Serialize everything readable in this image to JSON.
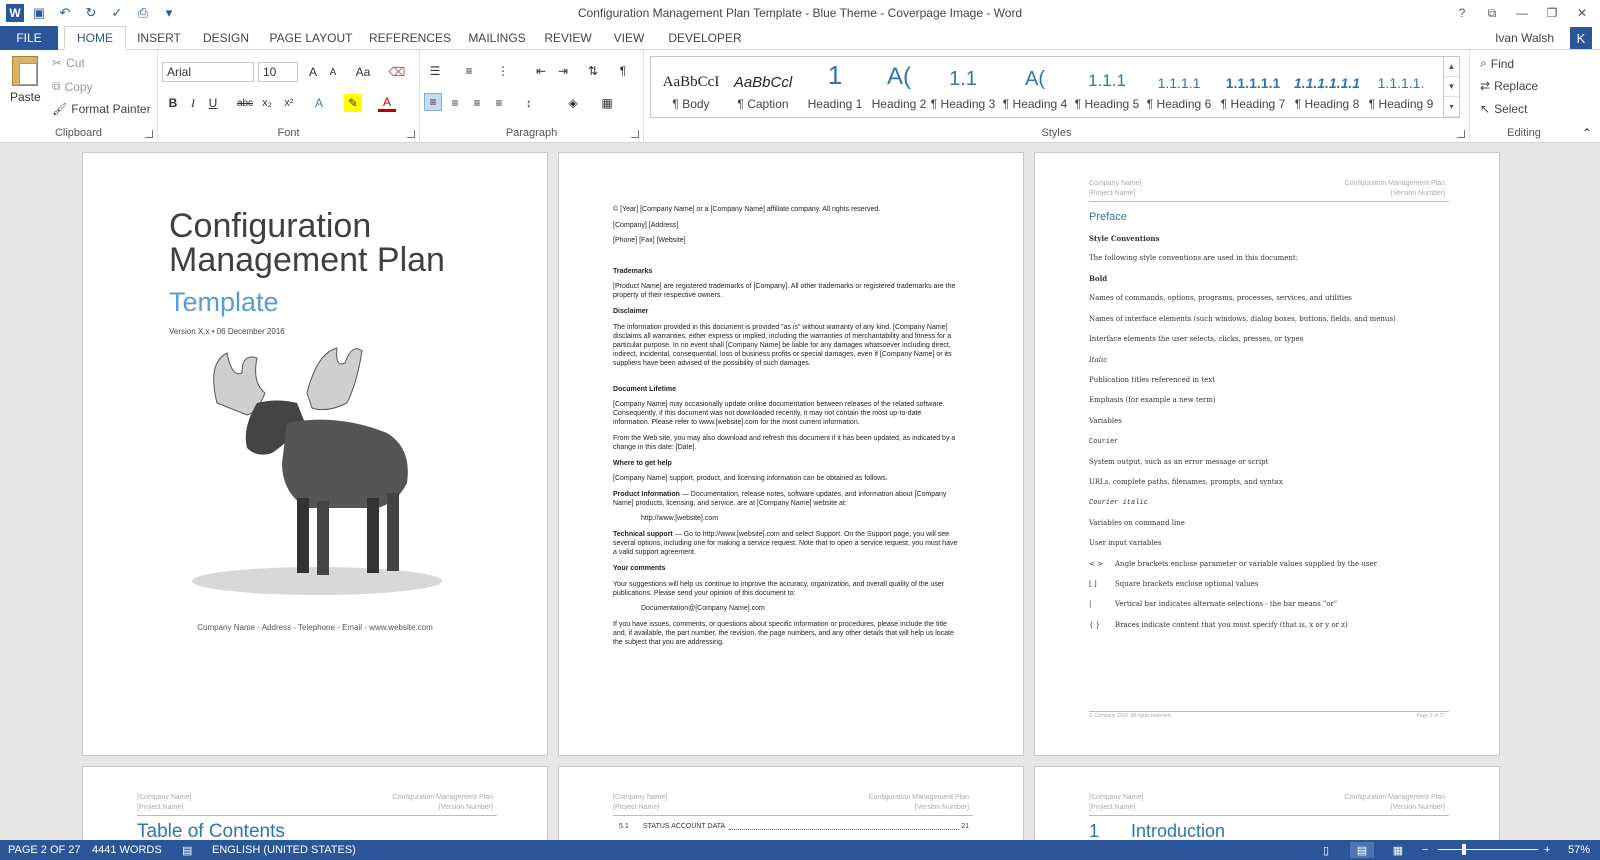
{
  "window": {
    "title": "Configuration Management Plan Template - Blue Theme - Coverpage Image - Word",
    "help": "?",
    "controls": [
      "⧉",
      "—",
      "❐",
      "✕"
    ]
  },
  "qat": {
    "logo": "W",
    "save_icon": "save-icon",
    "undo_icon": "undo-icon",
    "redo_icon": "redo-icon",
    "spell_icon": "spelling-icon",
    "more": "▾"
  },
  "tabs": [
    "FILE",
    "HOME",
    "INSERT",
    "DESIGN",
    "PAGE LAYOUT",
    "REFERENCES",
    "MAILINGS",
    "REVIEW",
    "VIEW",
    "DEVELOPER"
  ],
  "active_tab": "HOME",
  "user": {
    "name": "Ivan Walsh",
    "initial": "K"
  },
  "clipboard": {
    "label": "Clipboard",
    "paste": "Paste",
    "cut": "Cut",
    "copy": "Copy",
    "format_painter": "Format Painter"
  },
  "font": {
    "label": "Font",
    "name": "Arial",
    "size": "10"
  },
  "paragraph": {
    "label": "Paragraph"
  },
  "styles": {
    "label": "Styles",
    "items": [
      {
        "preview": "AaBbCcI",
        "name": "¶ Body"
      },
      {
        "preview": "AaBbCcl",
        "name": "¶ Caption"
      },
      {
        "preview": "1",
        "name": "Heading 1"
      },
      {
        "preview": "A(",
        "name": "Heading 2"
      },
      {
        "preview": "1.1",
        "name": "¶ Heading 3"
      },
      {
        "preview": "A(",
        "name": "¶ Heading 4"
      },
      {
        "preview": "1.1.1",
        "name": "¶ Heading 5"
      },
      {
        "preview": "1.1.1.1",
        "name": "¶ Heading 6"
      },
      {
        "preview": "1.1.1.1.1",
        "name": "¶ Heading 7"
      },
      {
        "preview": "1.1.1.1.1.1",
        "name": "¶ Heading 8"
      },
      {
        "preview": "1.1.1.1.",
        "name": "¶ Heading 9"
      }
    ]
  },
  "editing": {
    "label": "Editing",
    "find": "Find",
    "replace": "Replace",
    "select": "Select"
  },
  "page1": {
    "title_line1": "Configuration",
    "title_line2": "Management Plan",
    "subtitle": "Template",
    "version": "Version X.x • 06 December 2016",
    "footer": "Company Name - Address - Telephone - Email - www.website.com"
  },
  "page2": {
    "copyright": "© [Year] [Company Name] or a [Company Name] affiliate company. All rights reserved.",
    "address": "[Company] [Address]",
    "contact": "[Phone] [Fax] [Website]",
    "trademarks_h": "Trademarks",
    "trademarks": "[Product Name] are registered trademarks of [Company]. All other trademarks or registered trademarks are the property of their respective owners.",
    "disclaimer_h": "Disclaimer",
    "disclaimer": "The information provided in this document is provided \"as is\" without warranty of any kind. [Company Name] disclaims all warranties, either express or implied, including the warranties of merchantability and fitness for a particular purpose. In no event shall [Company Name] be liable for any damages whatsoever including direct, indirect, incidental, consequential, loss of business profits or special damages, even if [Company Name] or its suppliers have been advised of the possibility of such damages.",
    "lifetime_h": "Document Lifetime",
    "lifetime1": "[Company Name] may occasionally update online documentation between releases of the related software. Consequently, if this document was not downloaded recently, it may not contain the most up-to-date information. Please refer to www.[website].com for the most current information.",
    "lifetime2": "From the Web site, you may also download and refresh this document if it has been updated, as indicated by a change in this date: [Date].",
    "help_h": "Where to get help",
    "help": "[Company Name] support, product, and licensing information can be obtained as follows.",
    "product_h": "Product Information",
    "product": " — Documentation, release notes, software updates, and information about [Company Name] products, licensing, and service, are at [Company Name] website at:",
    "product_url": "http://www.[website].com",
    "tech_h": "Technical support",
    "tech": " — Go to http://www.[website].com and select Support. On the Support page, you will see several options, including one for making a service request. Note that to open a service request, you must have a valid support agreement.",
    "comments_h": "Your comments",
    "comments": "Your suggestions will help us continue to improve the accuracy, organization, and overall quality of the user publications. Please send your opinion of this document to:",
    "comments_email": "Documentation@[Company Name].com",
    "issues": "If you have issues, comments, or questions about specific information or procedures, please include the title and, if available, the part number, the revision, the page numbers, and any other details that will help us locate the subject that you are addressing."
  },
  "page3": {
    "hdr_left1": "Company Name]",
    "hdr_left2": "[Project Name]",
    "hdr_right1": "Configuration Management Plan",
    "hdr_right2": "[Version Number]",
    "heading": "Preface",
    "sub": "Style Conventions",
    "intro": "The following style conventions are used in this document:",
    "rows": [
      {
        "a": "Bold",
        "b": ""
      },
      {
        "a": "Names of commands, options, programs, processes, services, and utilities",
        "b": ""
      },
      {
        "a": "Names of interface elements (such windows, dialog boxes, buttons, fields, and menus)",
        "b": ""
      },
      {
        "a": "Interface elements the user selects, clicks, presses, or types",
        "b": ""
      },
      {
        "a": "Italic",
        "b": ""
      },
      {
        "a": "Publication titles referenced in text",
        "b": ""
      },
      {
        "a": "Emphasis (for example a new term)",
        "b": ""
      },
      {
        "a": "Variables",
        "b": ""
      },
      {
        "a": "Courier",
        "b": ""
      },
      {
        "a": "System output, such as an error message or script",
        "b": ""
      },
      {
        "a": "URLs, complete paths, filenames, prompts, and syntax",
        "b": ""
      },
      {
        "a": "Courier italic",
        "b": ""
      },
      {
        "a": "Variables on command line",
        "b": ""
      },
      {
        "a": "User input variables",
        "b": ""
      },
      {
        "a": "< >",
        "b": "Angle brackets enclose parameter or variable values supplied by the user"
      },
      {
        "a": "[ ]",
        "b": "Square brackets enclose optional values"
      },
      {
        "a": "|",
        "b": "Vertical bar indicates alternate selections - the bar means \"or\""
      },
      {
        "a": "{ }",
        "b": "Braces indicate content that you must specify (that is, x or y or z)"
      }
    ],
    "footer_left": "© Company 2016. All rights reserved.",
    "footer_right": "Page 3 of 27"
  },
  "page4": {
    "hdr_left1": "[Company Name]",
    "hdr_left2": "[Project Name]",
    "hdr_right1": "Configuration Management Plan",
    "hdr_right2": "[Version Number]",
    "heading": "Table of Contents"
  },
  "page5": {
    "hdr_left1": "[Company Name]",
    "hdr_left2": "[Project Name]",
    "hdr_right1": "Configuration Management Plan",
    "hdr_right2": "[Version Number]",
    "toc_num": "5.1",
    "toc_text": "STATUS ACCOUNT DATA",
    "toc_page": "21"
  },
  "page6": {
    "hdr_left1": "[Company Name]",
    "hdr_left2": "[Project Name]",
    "hdr_right1": "Configuration Management Plan",
    "hdr_right2": "[Version Number]",
    "heading_num": "1",
    "heading": "Introduction"
  },
  "status": {
    "page": "PAGE 2 OF 27",
    "words": "4441 WORDS",
    "lang": "ENGLISH (UNITED STATES)",
    "zoom": "57%",
    "zoom_minus": "−",
    "zoom_plus": "+",
    "zoom_level": 0.57
  },
  "colors": {
    "accent": "#2b579a",
    "heading_blue": "#5b9bd5"
  }
}
